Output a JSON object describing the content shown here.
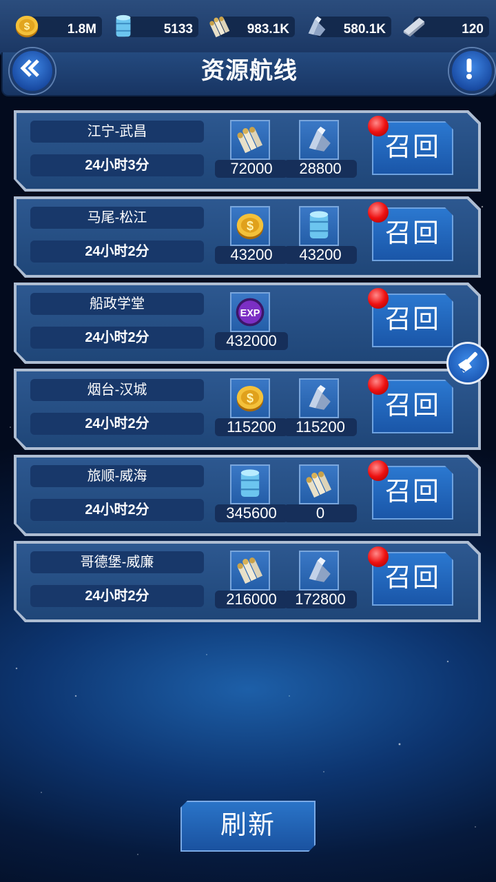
{
  "resources": [
    {
      "icon": "gold-coin-icon",
      "value": "1.8M"
    },
    {
      "icon": "oil-barrel-icon",
      "value": "5133"
    },
    {
      "icon": "ammo-shells-icon",
      "value": "983.1K"
    },
    {
      "icon": "steel-icon",
      "value": "580.1K"
    },
    {
      "icon": "silver-ingot-icon",
      "value": "120"
    }
  ],
  "header": {
    "title": "资源航线"
  },
  "recall_label": "召回",
  "routes": [
    {
      "name": "江宁-武昌",
      "time": "24小时3分",
      "rewards": [
        {
          "icon": "ammo-shells-icon",
          "amount": "72000"
        },
        {
          "icon": "steel-icon",
          "amount": "28800"
        }
      ]
    },
    {
      "name": "马尾-松江",
      "time": "24小时2分",
      "rewards": [
        {
          "icon": "gold-coin-icon",
          "amount": "43200"
        },
        {
          "icon": "oil-barrel-icon",
          "amount": "43200"
        }
      ]
    },
    {
      "name": "船政学堂",
      "time": "24小时2分",
      "rewards": [
        {
          "icon": "exp-icon",
          "amount": "432000"
        }
      ]
    },
    {
      "name": "烟台-汉城",
      "time": "24小时2分",
      "rewards": [
        {
          "icon": "gold-coin-icon",
          "amount": "115200"
        },
        {
          "icon": "steel-icon",
          "amount": "115200"
        }
      ]
    },
    {
      "name": "旅顺-威海",
      "time": "24小时2分",
      "rewards": [
        {
          "icon": "oil-barrel-icon",
          "amount": "345600"
        },
        {
          "icon": "ammo-shells-icon",
          "amount": "0"
        }
      ]
    },
    {
      "name": "哥德堡-威廉",
      "time": "24小时2分",
      "rewards": [
        {
          "icon": "ammo-shells-icon",
          "amount": "216000"
        },
        {
          "icon": "steel-icon",
          "amount": "172800"
        }
      ]
    }
  ],
  "refresh_label": "刷新",
  "exp_text": "EXP"
}
